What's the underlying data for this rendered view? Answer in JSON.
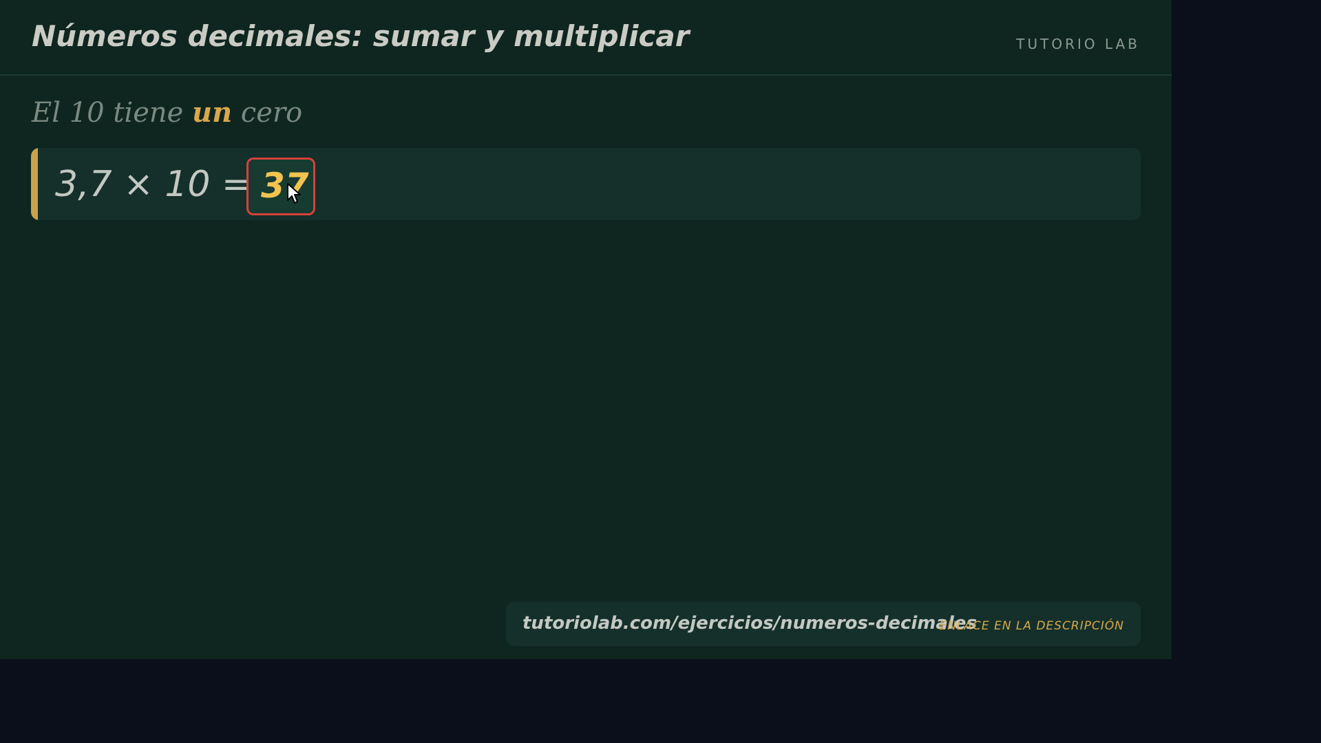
{
  "header": {
    "title": "Números decimales: sumar y multiplicar",
    "brand": "TUTORIO LAB"
  },
  "lesson": {
    "subtitle_pre": "El 10 tiene ",
    "subtitle_highlight": "un",
    "subtitle_post": " cero",
    "equation": "3,7 × 10 =",
    "answer": "37"
  },
  "footer": {
    "url": "tutoriolab.com/ejercicios/numeros-decimales",
    "note": "ENLACE EN LA DESCRIPCIÓN"
  },
  "colors": {
    "board": "#0f2620",
    "accent": "#c9a24a",
    "answer": "#f2c44f",
    "highlight_border": "#d6413a"
  },
  "icons": {
    "cursor": "mouse-pointer-icon"
  }
}
